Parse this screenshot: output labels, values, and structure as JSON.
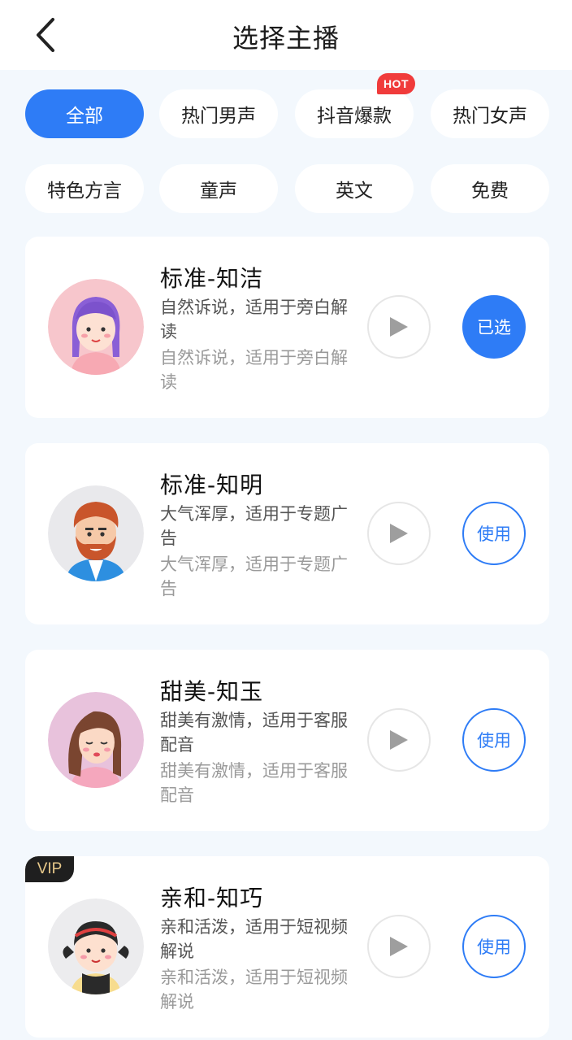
{
  "header": {
    "title": "选择主播",
    "back_icon": "chevron-left-icon"
  },
  "filters": [
    {
      "label": "全部",
      "active": true
    },
    {
      "label": "热门男声",
      "active": false
    },
    {
      "label": "抖音爆款",
      "active": false,
      "badge": "HOT"
    },
    {
      "label": "热门女声",
      "active": false
    },
    {
      "label": "特色方言",
      "active": false
    },
    {
      "label": "童声",
      "active": false
    },
    {
      "label": "英文",
      "active": false
    },
    {
      "label": "免费",
      "active": false
    }
  ],
  "voices": [
    {
      "name": "标准-知洁",
      "desc_primary": "自然诉说，适用于旁白解读",
      "desc_secondary": "自然诉说，适用于旁白解读",
      "action": "已选",
      "state": "selected",
      "avatar": "female-purple-hair-avatar"
    },
    {
      "name": "标准-知明",
      "desc_primary": "大气浑厚，适用于专题广告",
      "desc_secondary": "大气浑厚，适用于专题广告",
      "action": "使用",
      "state": "use",
      "avatar": "male-bearded-avatar"
    },
    {
      "name": "甜美-知玉",
      "desc_primary": "甜美有激情，适用于客服配音",
      "desc_secondary": "甜美有激情，适用于客服配音",
      "action": "使用",
      "state": "use",
      "avatar": "female-brown-hair-avatar"
    },
    {
      "name": "亲和-知巧",
      "desc_primary": "亲和活泼，适用于短视频解说",
      "desc_secondary": "亲和活泼，适用于短视频解说",
      "action": "使用",
      "state": "use",
      "avatar": "girl-pigtails-avatar",
      "badge": "VIP"
    }
  ],
  "colors": {
    "accent": "#2e7cf6",
    "hot": "#f03b3b",
    "background": "#f3f8fd"
  }
}
